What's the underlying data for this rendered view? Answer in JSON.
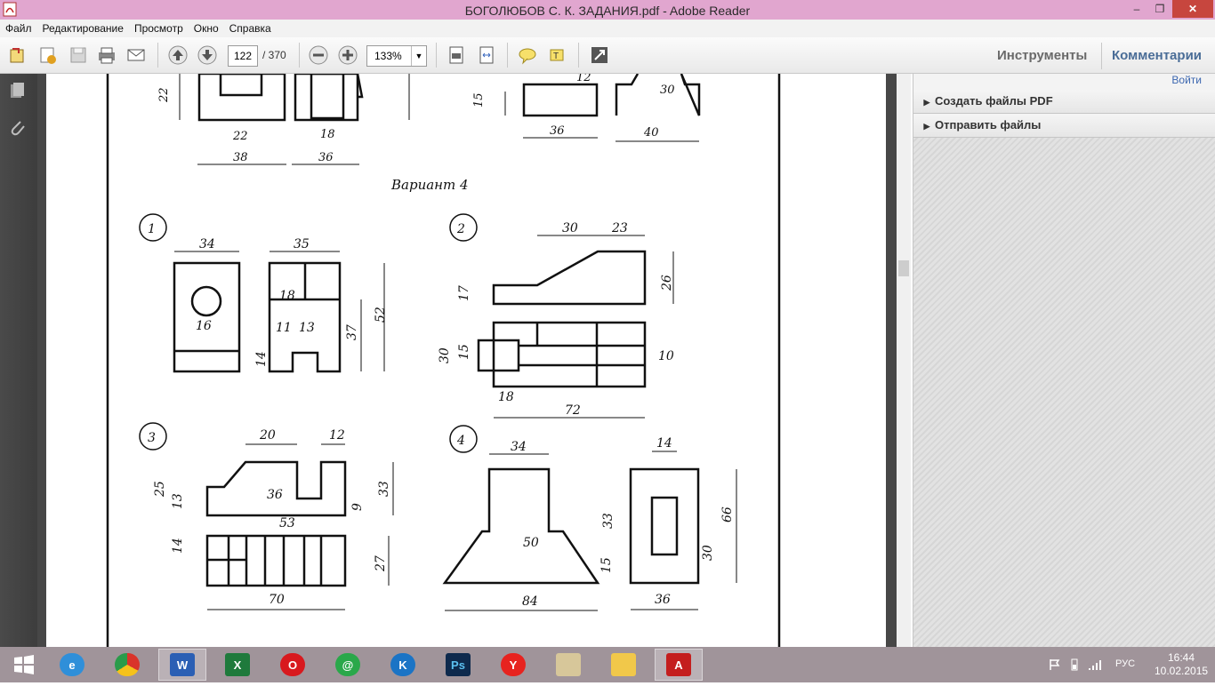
{
  "window": {
    "title": "БОГОЛЮБОВ С. К. ЗАДАНИЯ.pdf - Adobe Reader",
    "close_label": "✕",
    "minimize_label": "–",
    "restore_label": "❐"
  },
  "menu": [
    "Файл",
    "Редактирование",
    "Просмотр",
    "Окно",
    "Справка"
  ],
  "toolbar": {
    "page_current": "122",
    "page_total": "/ 370",
    "zoom": "133%",
    "tools_label": "Инструменты",
    "comments_label": "Комментарии"
  },
  "right_pane": {
    "signin": "Войти",
    "items": [
      "Создать файлы PDF",
      "Отправить файлы"
    ]
  },
  "document": {
    "variant_label": "Вариант 4",
    "task_numbers": [
      "1",
      "2",
      "3",
      "4"
    ],
    "dims_top": [
      "22",
      "22",
      "18",
      "38",
      "36",
      "15",
      "12",
      "30",
      "36",
      "40"
    ],
    "dims_task1": [
      "34",
      "35",
      "18",
      "16",
      "11",
      "13",
      "52",
      "37",
      "14"
    ],
    "dims_task2": [
      "30",
      "23",
      "17",
      "26",
      "30",
      "15",
      "10",
      "18",
      "72"
    ],
    "dims_task3": [
      "20",
      "12",
      "25",
      "13",
      "36",
      "33",
      "9",
      "53",
      "14",
      "27",
      "70"
    ],
    "dims_task4": [
      "34",
      "14",
      "33",
      "66",
      "50",
      "15",
      "30",
      "84",
      "36"
    ]
  },
  "taskbar": {
    "apps": [
      "start",
      "ie",
      "chrome",
      "word",
      "excel",
      "opera",
      "mail",
      "kaspersky",
      "photoshop",
      "yandex",
      "paint",
      "explorer",
      "acrobat"
    ],
    "lang": "РУС",
    "time": "16:44",
    "date": "10.02.2015"
  },
  "colors": {
    "title_bar": "#e1a6cf",
    "taskbar": "#a0949a",
    "link": "#4a6d97"
  }
}
